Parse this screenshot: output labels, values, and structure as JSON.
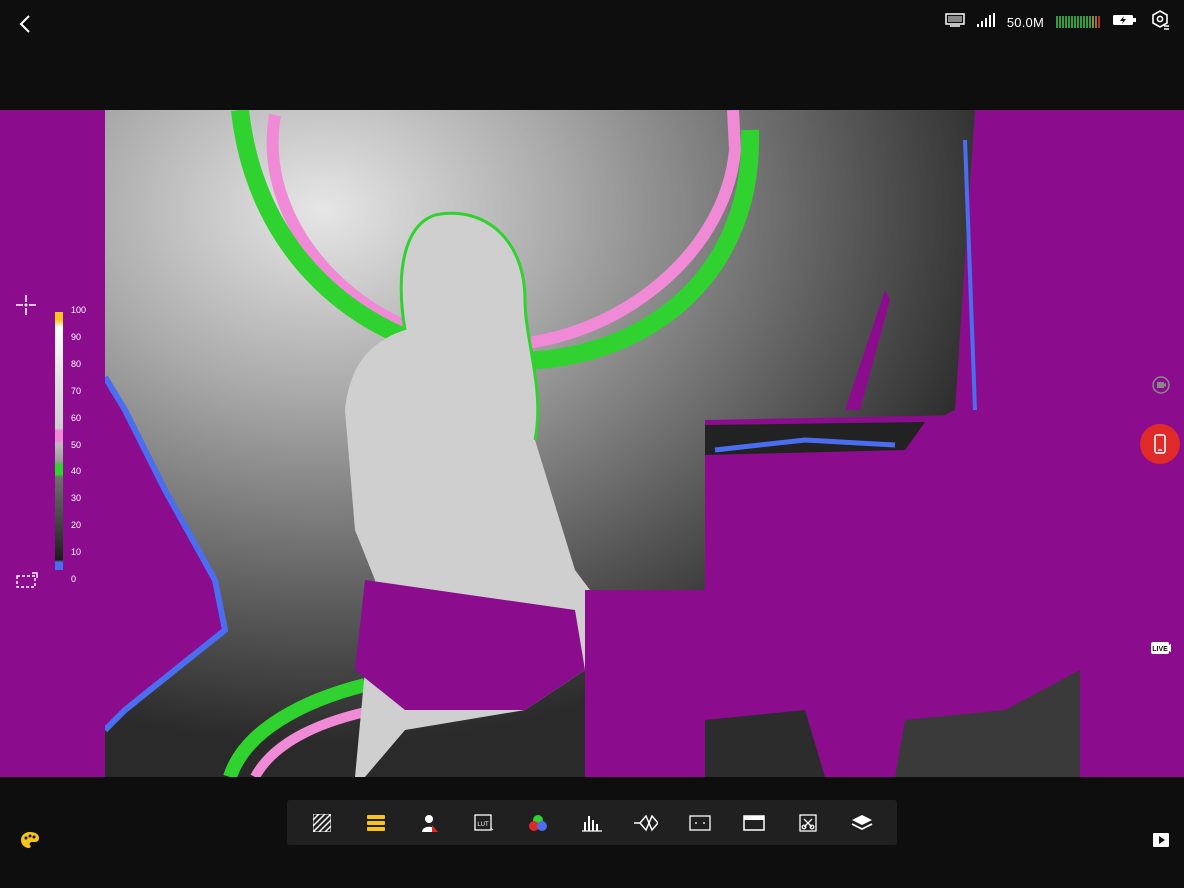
{
  "status": {
    "storage": "50.0M"
  },
  "histogram_scale": {
    "ticks": [
      "100",
      "90",
      "80",
      "70",
      "60",
      "50",
      "40",
      "30",
      "20",
      "10",
      "0"
    ]
  },
  "colors": {
    "false_color_purple": "#8b0d8e",
    "green_zone": "#2fd22f",
    "pink_zone": "#f08ad6",
    "blue_zone": "#4b6ef0",
    "record_red": "#e02a2a",
    "active_yellow": "#f5c518"
  },
  "toolbar": {
    "tools": [
      {
        "name": "zebra-icon",
        "active": false
      },
      {
        "name": "false-color-icon",
        "active": true
      },
      {
        "name": "skin-tone-icon",
        "active": false
      },
      {
        "name": "lut-icon",
        "active": false
      },
      {
        "name": "color-channels-icon",
        "active": false
      },
      {
        "name": "histogram-icon",
        "active": false
      },
      {
        "name": "waveform-icon",
        "active": false
      },
      {
        "name": "frame-guide-icon",
        "active": false
      },
      {
        "name": "aspect-ratio-icon",
        "active": false
      },
      {
        "name": "anamorphic-icon",
        "active": false
      },
      {
        "name": "layers-icon",
        "active": false
      }
    ]
  }
}
